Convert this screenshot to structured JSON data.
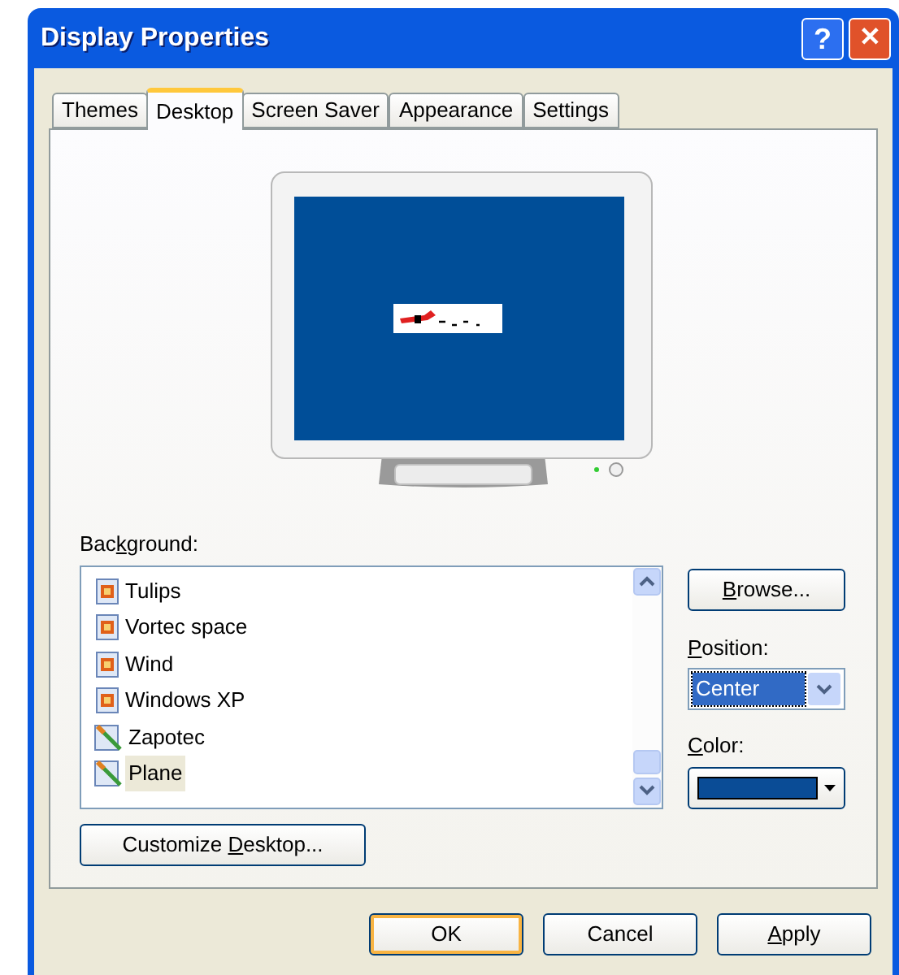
{
  "window": {
    "title": "Display Properties",
    "help_glyph": "?",
    "close_glyph": "✕"
  },
  "tabs": [
    {
      "label": "Themes",
      "selected": false
    },
    {
      "label": "Desktop",
      "selected": true
    },
    {
      "label": "Screen Saver",
      "selected": false
    },
    {
      "label": "Appearance",
      "selected": false
    },
    {
      "label": "Settings",
      "selected": false
    }
  ],
  "background": {
    "label": {
      "before": "Bac",
      "mnemonic": "k",
      "after": "ground:"
    },
    "items": [
      {
        "label": "Tulips",
        "kind": "page",
        "selected": false
      },
      {
        "label": "Vortec space",
        "kind": "page",
        "selected": false
      },
      {
        "label": "Wind",
        "kind": "page",
        "selected": false
      },
      {
        "label": "Windows XP",
        "kind": "page",
        "selected": false
      },
      {
        "label": "Zapotec",
        "kind": "picture",
        "selected": false
      },
      {
        "label": "Plane",
        "kind": "picture",
        "selected": true
      }
    ]
  },
  "browse_button": {
    "mnemonic": "B",
    "after": "rowse..."
  },
  "position": {
    "label": {
      "mnemonic": "P",
      "after": "osition:"
    },
    "value": "Center"
  },
  "color": {
    "label": {
      "mnemonic": "C",
      "after": "olor:"
    },
    "color": "#0a4c96"
  },
  "customize_button": {
    "before": "Customize ",
    "mnemonic": "D",
    "after": "esktop..."
  },
  "buttons": [
    {
      "label": {
        "before": "OK"
      },
      "selected": true
    },
    {
      "label": {
        "before": "Cancel"
      },
      "selected": false
    },
    {
      "label": {
        "mnemonic": "A",
        "after": "pply"
      },
      "selected": false
    }
  ]
}
